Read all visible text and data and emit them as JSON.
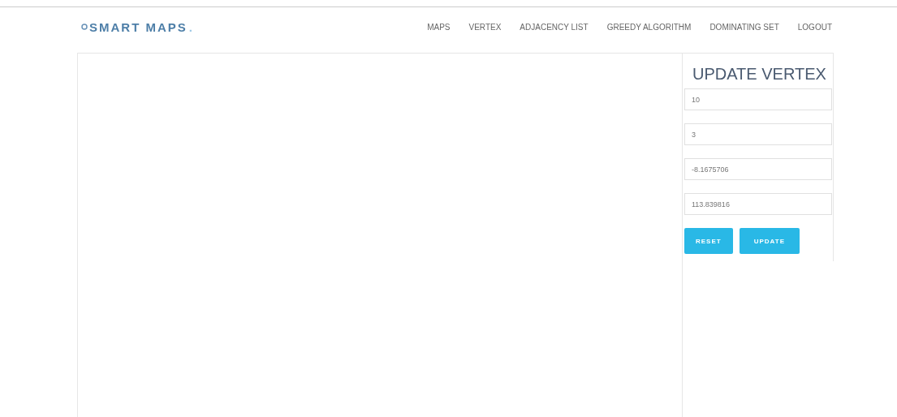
{
  "brand": {
    "name": "SMART MAPS",
    "suffix": "."
  },
  "nav": [
    {
      "label": "MAPS"
    },
    {
      "label": "VERTEX"
    },
    {
      "label": "ADJACENCY LIST"
    },
    {
      "label": "GREEDY ALGORITHM"
    },
    {
      "label": "DOMINATING SET"
    },
    {
      "label": "LOGOUT"
    }
  ],
  "form": {
    "title": "UPDATE VERTEX",
    "fields": [
      {
        "value": "10"
      },
      {
        "value": "3"
      },
      {
        "value": "-8.1675706"
      },
      {
        "value": "113.839816"
      }
    ],
    "buttons": [
      {
        "label": "RESET"
      },
      {
        "label": "UPDATE"
      }
    ]
  }
}
